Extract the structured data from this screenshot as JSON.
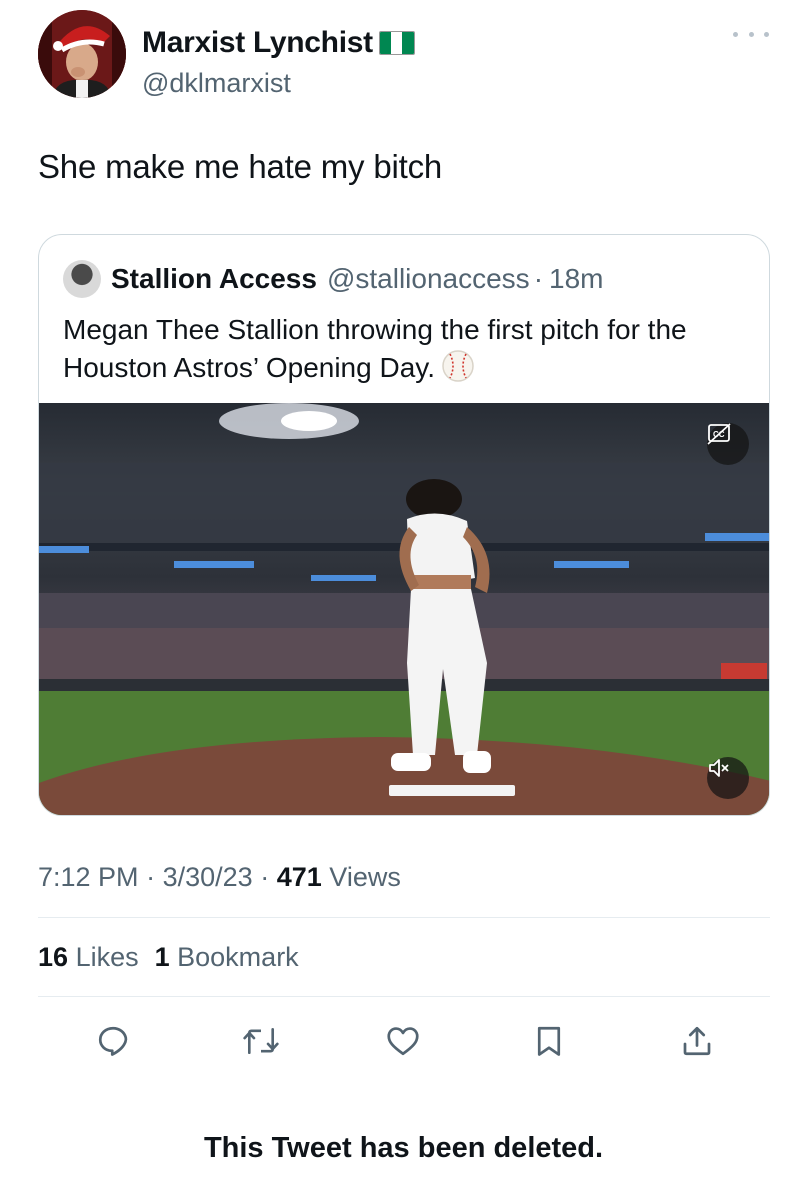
{
  "tweet": {
    "author": {
      "name": "Marxist Lynchist",
      "handle": "@dklmarxist",
      "flag_colors": [
        "#008751",
        "#ffffff",
        "#008751"
      ]
    },
    "text": "She make me hate my bitch",
    "quoted": {
      "name": "Stallion Access",
      "handle": "@stallionaccess",
      "separator": "·",
      "time": "18m",
      "text": "Megan Thee Stallion throwing the first pitch for the Houston Astros’ Opening Day.",
      "emoji_icon": "baseball-icon",
      "media": {
        "type": "video",
        "controls": [
          "closed-captions-icon",
          "muted-speaker-icon"
        ]
      }
    },
    "meta": {
      "time": "7:12 PM",
      "date": "3/30/23",
      "separator": "·",
      "views_count": "471",
      "views_label": "Views"
    },
    "stats": {
      "likes_count": "16",
      "likes_label": "Likes",
      "bookmarks_count": "1",
      "bookmarks_label": "Bookmark"
    },
    "actions": [
      "reply-icon",
      "retweet-icon",
      "like-icon",
      "bookmark-icon",
      "share-icon"
    ],
    "status_message": "This Tweet has been deleted."
  },
  "colors": {
    "text_primary": "#0f1419",
    "text_secondary": "#536471",
    "border": "#cfd9de",
    "divider": "#e6ecf0"
  }
}
